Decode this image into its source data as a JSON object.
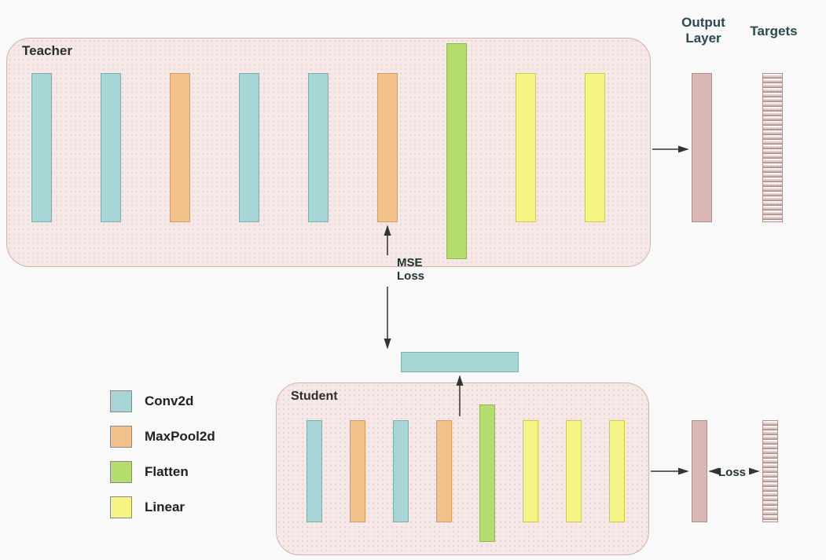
{
  "headers": {
    "output": "Output\nLayer",
    "targets": "Targets"
  },
  "boxes": {
    "teacher": "Teacher",
    "student": "Student"
  },
  "labels": {
    "mse": "MSE\nLoss",
    "loss": "Loss"
  },
  "legend": {
    "conv": "Conv2d",
    "maxpool": "MaxPool2d",
    "flatten": "Flatten",
    "linear": "Linear"
  },
  "chart_data": {
    "type": "diagram",
    "title": "Knowledge distillation with intermediate feature MSE loss",
    "teacher_layers": [
      "Conv2d",
      "Conv2d",
      "MaxPool2d",
      "Conv2d",
      "Conv2d",
      "MaxPool2d",
      "Flatten",
      "Linear",
      "Linear"
    ],
    "student_layers": [
      "Conv2d",
      "MaxPool2d",
      "Conv2d",
      "MaxPool2d",
      "Flatten",
      "Linear",
      "Linear",
      "Linear"
    ],
    "intermediate_block": "Conv2d",
    "losses": [
      {
        "name": "MSE Loss",
        "between": [
          "teacher.MaxPool2d[2]",
          "student.intermediate_block"
        ]
      },
      {
        "name": "Loss",
        "between": [
          "student.OutputLayer",
          "Targets"
        ]
      }
    ],
    "outputs": [
      "Output Layer",
      "Targets"
    ],
    "colors": {
      "Conv2d": "#a7d4d4",
      "MaxPool2d": "#f3c18b",
      "Flatten": "#b5dd6e",
      "Linear": "#f4f584",
      "OutputLayer": "#d9b8b4"
    }
  }
}
